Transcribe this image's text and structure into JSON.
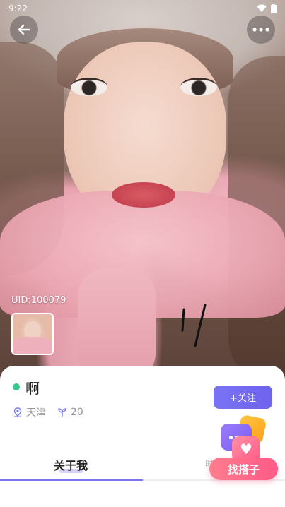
{
  "status_bar": {
    "time": "9:22"
  },
  "profile": {
    "uid": "UID:100079",
    "name": "啊",
    "location": "天津",
    "age": "20"
  },
  "actions": {
    "follow_label": "+关注"
  },
  "tabs": [
    {
      "label": "关于我",
      "active": true
    },
    {
      "label": "时",
      "active": false
    }
  ],
  "fab": {
    "label": "找搭子"
  },
  "colors": {
    "accent": "#7b73f0",
    "online": "#36c98e",
    "fab": "#ff5a86"
  }
}
